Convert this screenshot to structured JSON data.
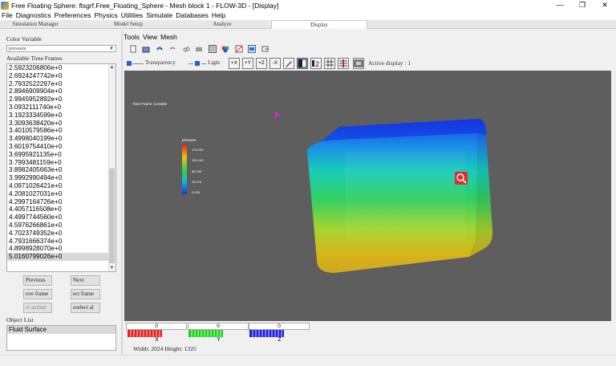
{
  "window": {
    "title": "Free Floating Sphere: flsgrf.Free_Floating_Sphere -  Mesh block 1 - FLOW-3D - [Display]",
    "minimize": "—",
    "maximize": "❐",
    "close": "✕"
  },
  "menubar": [
    "File",
    "Diagnostics",
    "Preferences",
    "Physics",
    "Utilities",
    "Simulate",
    "Databases",
    "Help"
  ],
  "tabs": [
    "Simulation Manager",
    "Model Setup",
    "Analyze",
    "Display"
  ],
  "left": {
    "color_variable_label": "Color Variable",
    "color_variable_value": "pressure",
    "time_frames_label": "Available Time Frames",
    "time_frames": [
      "2.5923206806e+0",
      "2.6924247742e+0",
      "2.7932522297e+0",
      "2.8946909904e+0",
      "2.9945952892e+0",
      "3.0932111740e+0",
      "3.1923334599e+0",
      "3.3093638420e+0",
      "3.4010579586e+0",
      "3.4998040199e+0",
      "3.6019754410e+0",
      "3.6995921135e+0",
      "3.7993481159e+0",
      "3.8982405663e+0",
      "3.9992990494e+0",
      "4.0971026421e+0",
      "4.2081027031e+0",
      "4.2997164726e+0",
      "4.4057116508e+0",
      "4.4997744560e+0",
      "4.5976266861e+0",
      "4.7023749352e+0",
      "4.7931666374e+0",
      "4.8998928070e+0",
      "5.0160799026e+0"
    ],
    "selected_time_frame": 24,
    "buttons": {
      "previous": "Previous",
      "next": "Next",
      "move_frame": "ove frame",
      "select_frame": "ect frame",
      "sel_animation": "el animat",
      "deselect_all": "eselect al"
    },
    "object_list_label": "Object List",
    "object_list": [
      "Fluid Surface"
    ]
  },
  "display": {
    "menu": [
      "Tools",
      "View",
      "Mesh"
    ],
    "transparency_label": "Transparency",
    "light_label": "Light",
    "axis_buttons": [
      "+X",
      "+Y",
      "+Z",
      "-X"
    ],
    "active_display": "Active display : 1",
    "time_frame_text": "Time Frame: 5.01608",
    "legend": {
      "title": "pressure",
      "ticks": [
        "176.233",
        "132.163",
        "88.130",
        "44.078",
        "0.026"
      ]
    },
    "axes": [
      {
        "label": "X",
        "value": "0",
        "color": "#e02020"
      },
      {
        "label": "Y",
        "value": "0",
        "color": "#20d020"
      },
      {
        "label": "Z",
        "value": "0",
        "color": "#2020e0"
      }
    ],
    "dimensions": "Width: 2024 Height: 1325"
  },
  "colors": {
    "viewport_bg": "#5e5e5e",
    "accent": "#1e64d0",
    "selected": "#d9d9d9"
  }
}
